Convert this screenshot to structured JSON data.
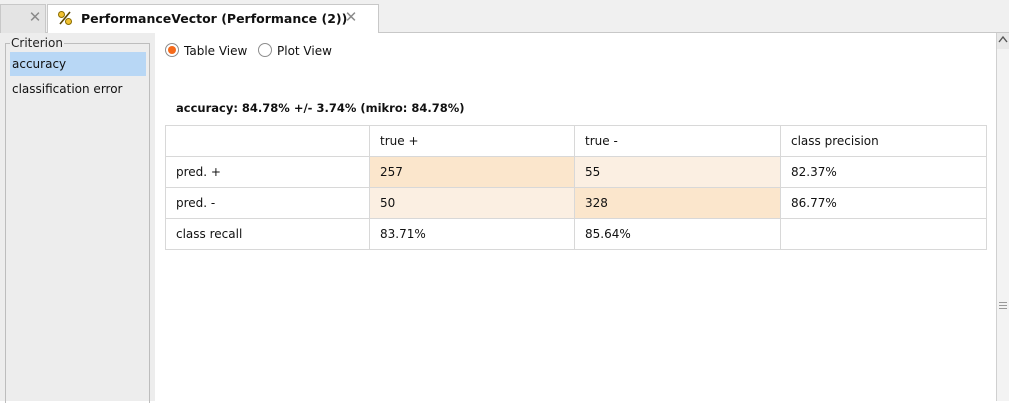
{
  "tabs": {
    "previous_close": "✕",
    "active_title": "PerformanceVector (Performance (2))",
    "active_close": "✕",
    "active_icon": "percent-icon"
  },
  "criterion": {
    "legend": "Criterion",
    "items": [
      "accuracy",
      "classification error"
    ],
    "selected": "accuracy"
  },
  "view_options": {
    "table_view": "Table View",
    "plot_view": "Plot View",
    "selected": "Table View"
  },
  "summary": "accuracy: 84.78% +/- 3.74% (mikro: 84.78%)",
  "matrix": {
    "header": [
      "",
      "true +",
      "true -",
      "class precision"
    ],
    "rows": [
      [
        "pred. +",
        "257",
        "55",
        "82.37%"
      ],
      [
        "pred. -",
        "50",
        "328",
        "86.77%"
      ],
      [
        "class recall",
        "83.71%",
        "85.64%",
        ""
      ]
    ]
  },
  "colors": {
    "selected_item_bg": "#b8d7f5",
    "radio_accent": "#f56a1b",
    "cell_highlight_strong": "#fbe6cc",
    "cell_highlight_soft": "#fbefe2"
  }
}
